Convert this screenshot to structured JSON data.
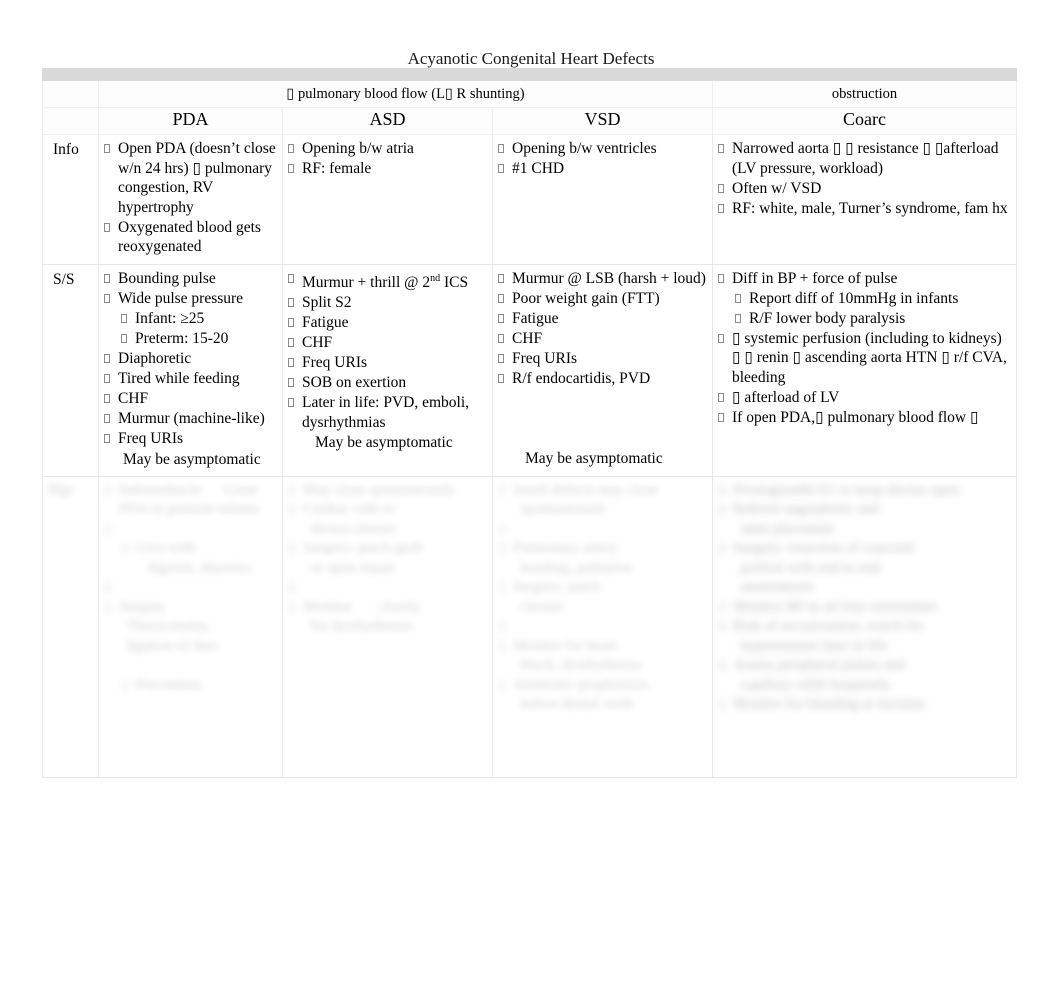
{
  "document": {
    "title": "Acyanotic Congenital Heart Defects"
  },
  "table": {
    "group_headers": {
      "increased_flow": "▯ pulmonary blood flow (L▯ R shunting)",
      "obstruction": "obstruction"
    },
    "columns": [
      {
        "key": "label",
        "header": ""
      },
      {
        "key": "pda",
        "header": "PDA"
      },
      {
        "key": "asd",
        "header": "ASD"
      },
      {
        "key": "vsd",
        "header": "VSD"
      },
      {
        "key": "coarc",
        "header": "Coarc"
      }
    ],
    "rows": [
      {
        "label": "Info",
        "pda": {
          "bullets": [
            "Open PDA (doesn’t close w/n 24 hrs) ▯ pulmonary congestion, RV hypertrophy",
            "Oxygenated blood gets reoxygenated"
          ]
        },
        "asd": {
          "bullets": [
            "Opening b/w atria",
            "RF: female"
          ]
        },
        "vsd": {
          "bullets": [
            "Opening b/w ventricles",
            "#1 CHD"
          ]
        },
        "coarc": {
          "bullets": [
            "Narrowed aorta ▯  ▯ resistance ▯ ▯afterload (LV pressure, workload)",
            "Often w/ VSD",
            "RF: white, male, Turner’s syndrome, fam hx"
          ]
        }
      },
      {
        "label": "S/S",
        "pda": {
          "bullets": [
            "Bounding pulse",
            "Wide pulse pressure",
            "Diaphoretic",
            "Tired while feeding",
            "CHF",
            "Murmur (machine-like)",
            "Freq URIs"
          ],
          "subs": {
            "wide_pulse_pressure": [
              "Infant: ≥25",
              "Preterm: 15-20"
            ]
          },
          "note": "May be asymptomatic"
        },
        "asd": {
          "bullets": [
            "Murmur + thrill @ 2nd ICS",
            "Split S2",
            "Fatigue",
            "CHF",
            "Freq URIs",
            "SOB on exertion",
            "Later in life: PVD, emboli, dysrhythmias"
          ],
          "note": "May be asymptomatic"
        },
        "vsd": {
          "bullets": [
            "Murmur @ LSB (harsh + loud)",
            "Poor weight gain (FTT)",
            "Fatigue",
            "CHF",
            "Freq URIs",
            "R/f endocartidis, PVD"
          ],
          "note": "May be asymptomatic"
        },
        "coarc": {
          "bullets": [
            "Diff in BP + force of pulse",
            "▯ systemic perfusion (including to kidneys) ▯  ▯ renin ▯  ascending aorta HTN ▯  r/f CVA, bleeding",
            "▯ afterload of LV",
            "If open PDA,▯ pulmonary blood flow ▯"
          ],
          "subs": {
            "diff_in_bp": [
              "Report diff of 10mmHg in infants",
              "R/F lower body paralysis"
            ]
          }
        }
      },
      {
        "label": "",
        "illegible": true,
        "note": "This row is rendered blurred and out of focus in the source image; its text is not legible."
      }
    ]
  },
  "glyphs": {
    "bullet": "missing-glyph-box",
    "arrow": "missing-glyph-box"
  },
  "colors": {
    "band": "#d9d9d9",
    "border": "#e7e7e7",
    "text": "#000000"
  }
}
